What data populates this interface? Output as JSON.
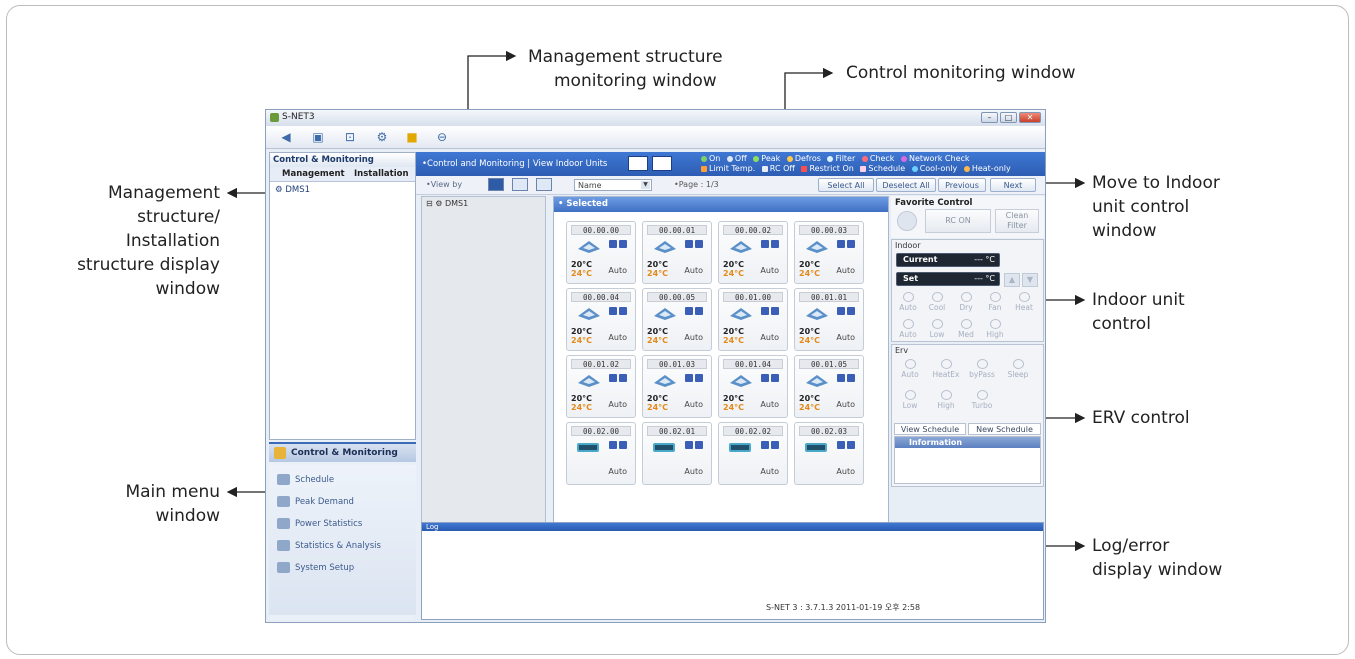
{
  "annotations": {
    "mgmt_monitoring": [
      "Management structure",
      "monitoring window"
    ],
    "control_monitoring": "Control monitoring window",
    "mgmt_display": [
      "Management",
      "structure/",
      "Installation",
      "structure display",
      "window"
    ],
    "move_indoor": [
      "Move to Indoor",
      "unit control",
      "window"
    ],
    "indoor_control": [
      "Indoor unit",
      "control"
    ],
    "erv_control": "ERV control",
    "main_menu": [
      "Main menu",
      "window"
    ],
    "log_error": [
      "Log/error",
      "display window"
    ]
  },
  "app": {
    "title": "S-NET3",
    "left_header": "Control & Monitoring",
    "tabs": [
      "Management",
      "Installation"
    ],
    "tree_root": "DMS1",
    "section_bar": "Control & Monitoring",
    "menu": [
      "Schedule",
      "Peak Demand",
      "Power Statistics",
      "Statistics & Analysis",
      "System Setup"
    ],
    "breadcrumb": "•Control and Monitoring  |  View Indoor Units",
    "legend_row1": [
      "On",
      "Off",
      "Peak",
      "Defros",
      "Filter",
      "Check",
      "Network Check"
    ],
    "legend_row2": [
      "Limit Temp.",
      "RC Off",
      "Restrict On",
      "Schedule",
      "Cool-only",
      "Heat-only"
    ],
    "legend_colors": {
      "on": "#7cd06a",
      "off": "#dfe7f2",
      "peak": "#8de05a",
      "defros": "#ffc94a",
      "filter": "#d9f0ff",
      "check": "#ff6a7a",
      "network": "#d86ae0",
      "limit": "#ff9d3a",
      "rcoff": "#e7eef8",
      "restrict": "#ff4d4d",
      "schedule": "#ffd0e6",
      "cool": "#6ad0ff",
      "heat": "#ffb64a"
    },
    "view_by": "•View by",
    "sort_select": "Name",
    "page": "•Page : 1/3",
    "nav_buttons": [
      "Select All",
      "Deselect All",
      "Previous",
      "Next"
    ],
    "tree_node": "DMS1",
    "selected_title": "• Selected",
    "units": [
      {
        "id": "00.00.00",
        "temp": "20°C",
        "set": "24°C",
        "mode": "Auto"
      },
      {
        "id": "00.00.01",
        "temp": "20°C",
        "set": "24°C",
        "mode": "Auto"
      },
      {
        "id": "00.00.02",
        "temp": "20°C",
        "set": "24°C",
        "mode": "Auto"
      },
      {
        "id": "00.00.03",
        "temp": "20°C",
        "set": "24°C",
        "mode": "Auto"
      },
      {
        "id": "00.00.04",
        "temp": "20°C",
        "set": "24°C",
        "mode": "Auto"
      },
      {
        "id": "00.00.05",
        "temp": "20°C",
        "set": "24°C",
        "mode": "Auto"
      },
      {
        "id": "00.01.00",
        "temp": "20°C",
        "set": "24°C",
        "mode": "Auto"
      },
      {
        "id": "00.01.01",
        "temp": "20°C",
        "set": "24°C",
        "mode": "Auto"
      },
      {
        "id": "00.01.02",
        "temp": "20°C",
        "set": "24°C",
        "mode": "Auto"
      },
      {
        "id": "00.01.03",
        "temp": "20°C",
        "set": "24°C",
        "mode": "Auto"
      },
      {
        "id": "00.01.04",
        "temp": "20°C",
        "set": "24°C",
        "mode": "Auto"
      },
      {
        "id": "00.01.05",
        "temp": "20°C",
        "set": "24°C",
        "mode": "Auto"
      },
      {
        "id": "00.02.00",
        "temp": "",
        "set": "",
        "mode": "Auto"
      },
      {
        "id": "00.02.01",
        "temp": "",
        "set": "",
        "mode": "Auto"
      },
      {
        "id": "00.02.02",
        "temp": "",
        "set": "",
        "mode": "Auto"
      },
      {
        "id": "00.02.03",
        "temp": "",
        "set": "",
        "mode": "Auto"
      }
    ],
    "favorite_title": "Favorite Control",
    "rc_on": "RC ON",
    "clean_filter": [
      "Clean",
      "Filter"
    ],
    "indoor_title": "Indoor",
    "current_label": "Current",
    "current_value": "--- °C",
    "set_label": "Set",
    "set_value": "--- °C",
    "modes": [
      "Auto",
      "Cool",
      "Dry",
      "Fan",
      "Heat"
    ],
    "fans": [
      "Auto",
      "Low",
      "Med",
      "High"
    ],
    "erv_title": "Erv",
    "erv_modes": [
      "Auto",
      "HeatEx",
      "byPass",
      "Sleep"
    ],
    "erv_fans": [
      "Low",
      "High",
      "Turbo"
    ],
    "view_schedule": "View Schedule",
    "new_schedule": "New Schedule",
    "information": "Information",
    "log_title": "Log",
    "status": "S-NET 3 : 3.7.1.3    2011-01-19    오후 2:58"
  }
}
